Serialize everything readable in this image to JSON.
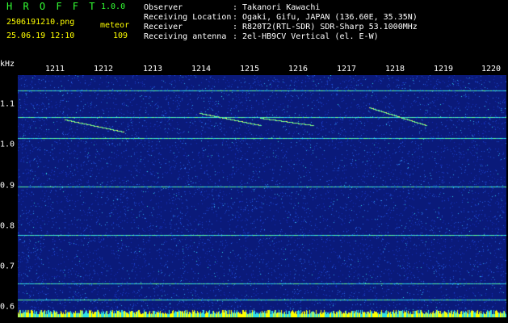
{
  "header": {
    "app_name": "H R O F F T",
    "version": "1.0.0",
    "filename": "2506191210.png",
    "mode": "meteor",
    "datetime": "25.06.19 12:10",
    "count": "109"
  },
  "info": [
    {
      "label": "Observer",
      "value": ": Takanori Kawachi"
    },
    {
      "label": "Receiving Location",
      "value": ": Ogaki, Gifu, JAPAN (136.60E, 35.35N)"
    },
    {
      "label": "Receiver",
      "value": ": R820T2(RTL-SDR) SDR-Sharp 53.1000MHz"
    },
    {
      "label": "Receiving antenna",
      "value": ": 2el-HB9CV Vertical (el. E-W)"
    }
  ],
  "axis": {
    "y_unit": "kHz",
    "x_ticks": [
      "1211",
      "1212",
      "1213",
      "1214",
      "1215",
      "1216",
      "1217",
      "1218",
      "1219",
      "1220"
    ],
    "y_ticks": [
      "1.1",
      "1.0",
      "0.9",
      "0.8",
      "0.7",
      "0.6"
    ]
  },
  "colors": {
    "title": "#33ff33",
    "info_text": "#ffffff",
    "meta_text": "#ffff00",
    "background": "#0a1a7a"
  }
}
